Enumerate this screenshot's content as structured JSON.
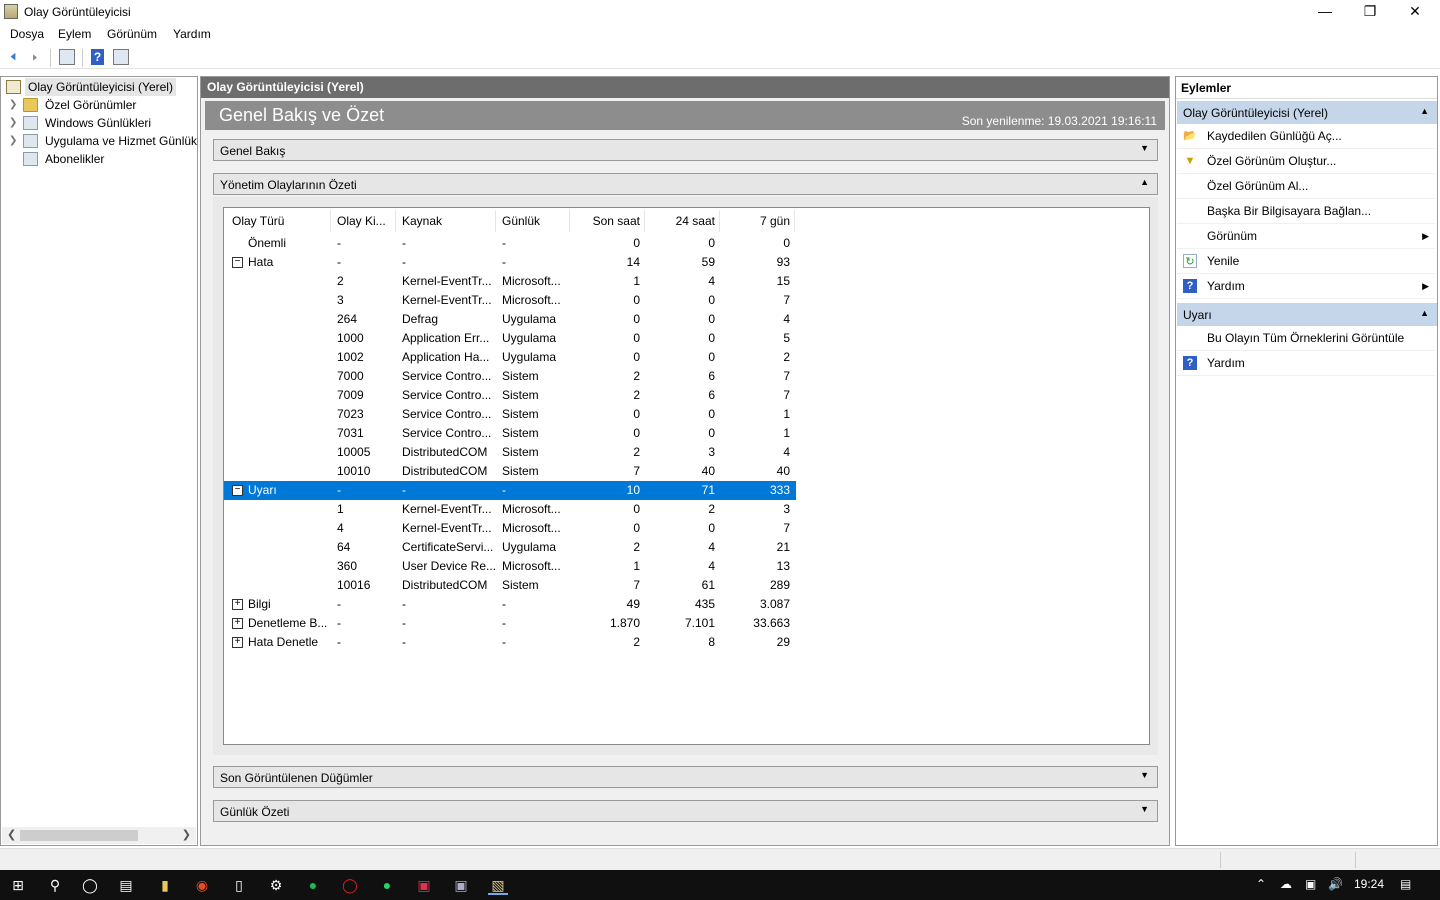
{
  "window": {
    "title": "Olay Görüntüleyicisi"
  },
  "menu": [
    "Dosya",
    "Eylem",
    "Görünüm",
    "Yardım"
  ],
  "tree": {
    "root": "Olay Görüntüleyicisi (Yerel)",
    "items": [
      "Özel Görünümler",
      "Windows Günlükleri",
      "Uygulama ve Hizmet Günlükleri",
      "Abonelikler"
    ]
  },
  "center": {
    "header": "Olay Görüntüleyicisi (Yerel)",
    "banner_title": "Genel Bakış ve Özet",
    "last_refresh": "Son yenilenme: 19.03.2021 19:16:11",
    "sections": {
      "overview": "Genel Bakış",
      "admin_summary": "Yönetim Olaylarının Özeti",
      "recent_nodes": "Son Görüntülenen Düğümler",
      "log_summary": "Günlük Özeti"
    },
    "columns": [
      "Olay Türü",
      "Olay Ki...",
      "Kaynak",
      "Günlük",
      "Son saat",
      "24 saat",
      "7 gün"
    ],
    "rows": [
      {
        "type": "Önemli",
        "id": "-",
        "source": "-",
        "log": "-",
        "h": "0",
        "d": "0",
        "w": "0"
      },
      {
        "type": "Hata",
        "id": "-",
        "source": "-",
        "log": "-",
        "h": "14",
        "d": "59",
        "w": "93",
        "toggle": "−"
      },
      {
        "type": "",
        "id": "2",
        "source": "Kernel-EventTr...",
        "log": "Microsoft...",
        "h": "1",
        "d": "4",
        "w": "15"
      },
      {
        "type": "",
        "id": "3",
        "source": "Kernel-EventTr...",
        "log": "Microsoft...",
        "h": "0",
        "d": "0",
        "w": "7"
      },
      {
        "type": "",
        "id": "264",
        "source": "Defrag",
        "log": "Uygulama",
        "h": "0",
        "d": "0",
        "w": "4"
      },
      {
        "type": "",
        "id": "1000",
        "source": "Application Err...",
        "log": "Uygulama",
        "h": "0",
        "d": "0",
        "w": "5"
      },
      {
        "type": "",
        "id": "1002",
        "source": "Application Ha...",
        "log": "Uygulama",
        "h": "0",
        "d": "0",
        "w": "2"
      },
      {
        "type": "",
        "id": "7000",
        "source": "Service Contro...",
        "log": "Sistem",
        "h": "2",
        "d": "6",
        "w": "7"
      },
      {
        "type": "",
        "id": "7009",
        "source": "Service Contro...",
        "log": "Sistem",
        "h": "2",
        "d": "6",
        "w": "7"
      },
      {
        "type": "",
        "id": "7023",
        "source": "Service Contro...",
        "log": "Sistem",
        "h": "0",
        "d": "0",
        "w": "1"
      },
      {
        "type": "",
        "id": "7031",
        "source": "Service Contro...",
        "log": "Sistem",
        "h": "0",
        "d": "0",
        "w": "1"
      },
      {
        "type": "",
        "id": "10005",
        "source": "DistributedCOM",
        "log": "Sistem",
        "h": "2",
        "d": "3",
        "w": "4"
      },
      {
        "type": "",
        "id": "10010",
        "source": "DistributedCOM",
        "log": "Sistem",
        "h": "7",
        "d": "40",
        "w": "40"
      },
      {
        "type": "Uyarı",
        "id": "-",
        "source": "-",
        "log": "-",
        "h": "10",
        "d": "71",
        "w": "333",
        "toggle": "−",
        "selected": true
      },
      {
        "type": "",
        "id": "1",
        "source": "Kernel-EventTr...",
        "log": "Microsoft...",
        "h": "0",
        "d": "2",
        "w": "3"
      },
      {
        "type": "",
        "id": "4",
        "source": "Kernel-EventTr...",
        "log": "Microsoft...",
        "h": "0",
        "d": "0",
        "w": "7"
      },
      {
        "type": "",
        "id": "64",
        "source": "CertificateServi...",
        "log": "Uygulama",
        "h": "2",
        "d": "4",
        "w": "21"
      },
      {
        "type": "",
        "id": "360",
        "source": "User Device Re...",
        "log": "Microsoft...",
        "h": "1",
        "d": "4",
        "w": "13"
      },
      {
        "type": "",
        "id": "10016",
        "source": "DistributedCOM",
        "log": "Sistem",
        "h": "7",
        "d": "61",
        "w": "289"
      },
      {
        "type": "Bilgi",
        "id": "-",
        "source": "-",
        "log": "-",
        "h": "49",
        "d": "435",
        "w": "3.087",
        "toggle": "+"
      },
      {
        "type": "Denetleme B...",
        "id": "-",
        "source": "-",
        "log": "-",
        "h": "1.870",
        "d": "7.101",
        "w": "33.663",
        "toggle": "+"
      },
      {
        "type": "Hata Denetle",
        "id": "-",
        "source": "-",
        "log": "-",
        "h": "2",
        "d": "8",
        "w": "29",
        "toggle": "+"
      }
    ]
  },
  "actions": {
    "title": "Eylemler",
    "group1": "Olay Görüntüleyicisi (Yerel)",
    "group1_items": [
      {
        "label": "Kaydedilen Günlüğü Aç...",
        "icon": "folder-open-icon"
      },
      {
        "label": "Özel Görünüm Oluştur...",
        "icon": "filter-icon"
      },
      {
        "label": "Özel Görünüm Al...",
        "icon": ""
      },
      {
        "label": "Başka Bir Bilgisayara Bağlan...",
        "icon": ""
      },
      {
        "label": "Görünüm",
        "icon": "",
        "submenu": true
      },
      {
        "label": "Yenile",
        "icon": "refresh-icon"
      },
      {
        "label": "Yardım",
        "icon": "help-icon",
        "submenu": true
      }
    ],
    "group2": "Uyarı",
    "group2_items": [
      {
        "label": "Bu Olayın Tüm Örneklerini Görüntüle",
        "icon": ""
      },
      {
        "label": "Yardım",
        "icon": "help-icon"
      }
    ]
  },
  "taskbar": {
    "time": "19:24"
  },
  "colors": {
    "selection": "#0078d7",
    "actions_group": "#c6d6ea",
    "center_header": "#6d6d6d",
    "banner": "#8d8d8d"
  }
}
